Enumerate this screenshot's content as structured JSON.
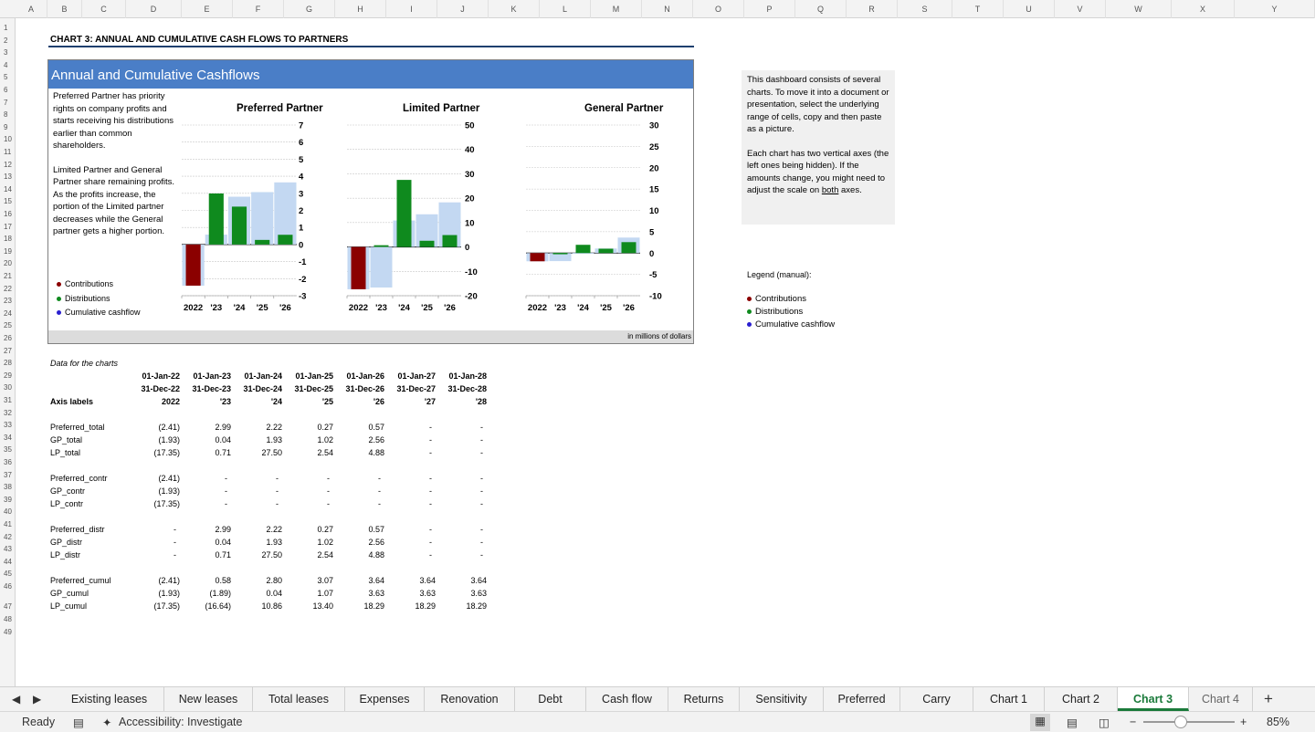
{
  "columns": [
    "A",
    "B",
    "C",
    "D",
    "E",
    "F",
    "G",
    "H",
    "I",
    "J",
    "K",
    "L",
    "M",
    "N",
    "O",
    "P",
    "Q",
    "R",
    "S",
    "T",
    "U",
    "V",
    "W",
    "X",
    "Y"
  ],
  "rows": [
    "1",
    "2",
    "3",
    "4",
    "5",
    "6",
    "7",
    "8",
    "9",
    "10",
    "11",
    "12",
    "13",
    "14",
    "15",
    "16",
    "17",
    "18",
    "19",
    "20",
    "21",
    "22",
    "23",
    "24",
    "25",
    "26",
    "27",
    "28",
    "29",
    "30",
    "31",
    "32",
    "33",
    "34",
    "35",
    "36",
    "37",
    "38",
    "39",
    "40",
    "41",
    "42",
    "43",
    "44",
    "45",
    "46",
    "47",
    "48",
    "49"
  ],
  "sheet_title": "CHART 3: ANNUAL AND CUMULATIVE CASH FLOWS TO PARTNERS",
  "dashboard": {
    "title": "Annual and Cumulative Cashflows",
    "desc_p1": "Preferred Partner has priority rights on company profits and starts receiving his distributions earlier than common shareholders.",
    "desc_p2": "Limited Partner and General Partner share remaining profits. As the profits increase, the portion of the Limited partner decreases while the General partner gets a higher portion.",
    "legend": [
      "Contributions",
      "Distributions",
      "Cumulative cashflow"
    ],
    "footer": "in millions of dollars"
  },
  "colors": {
    "contributions": "#8b0000",
    "distributions": "#0f8a1e",
    "cumulative": "#c3d8f2",
    "legend_cumulative": "#2a1fd0",
    "header": "#4a7ec7",
    "active_tab": "#1a7a3a"
  },
  "chart_data": [
    {
      "type": "bar",
      "title": "Preferred Partner",
      "categories": [
        "2022",
        "'23",
        "'24",
        "'25",
        "'26"
      ],
      "ylim": [
        -3,
        7
      ],
      "yticks": [
        "7",
        "6",
        "5",
        "4",
        "3",
        "2",
        "1",
        "0",
        "-1",
        "-2",
        "-3"
      ],
      "series": [
        {
          "name": "Contributions",
          "values": [
            -2.41,
            0,
            0,
            0,
            0
          ]
        },
        {
          "name": "Distributions",
          "values": [
            0,
            2.99,
            2.22,
            0.27,
            0.57
          ]
        },
        {
          "name": "Cumulative cashflow",
          "values": [
            -2.41,
            0.58,
            2.8,
            3.07,
            3.64
          ]
        }
      ]
    },
    {
      "type": "bar",
      "title": "Limited Partner",
      "categories": [
        "2022",
        "'23",
        "'24",
        "'25",
        "'26"
      ],
      "ylim": [
        -20,
        50
      ],
      "yticks": [
        "50",
        "40",
        "30",
        "20",
        "10",
        "0",
        "-10",
        "-20"
      ],
      "series": [
        {
          "name": "Contributions",
          "values": [
            -17.35,
            0,
            0,
            0,
            0
          ]
        },
        {
          "name": "Distributions",
          "values": [
            0,
            0.71,
            27.5,
            2.54,
            4.88
          ]
        },
        {
          "name": "Cumulative cashflow",
          "values": [
            -17.35,
            -16.64,
            10.86,
            13.4,
            18.29
          ]
        }
      ]
    },
    {
      "type": "bar",
      "title": "General Partner",
      "categories": [
        "2022",
        "'23",
        "'24",
        "'25",
        "'26"
      ],
      "ylim": [
        -10,
        30
      ],
      "yticks": [
        "30",
        "25",
        "20",
        "15",
        "10",
        "5",
        "0",
        "-5",
        "-10"
      ],
      "series": [
        {
          "name": "Contributions",
          "values": [
            -1.93,
            0,
            0,
            0,
            0
          ]
        },
        {
          "name": "Distributions",
          "values": [
            0,
            0.04,
            1.93,
            1.02,
            2.56
          ]
        },
        {
          "name": "Cumulative cashflow",
          "values": [
            -1.93,
            -1.89,
            0.04,
            1.07,
            3.63
          ]
        }
      ]
    }
  ],
  "note": {
    "p1": "This dashboard consists of several charts. To move it into a document or presentation, select the underlying range of cells, copy and then paste as a picture.",
    "p2_a": "Each chart has two vertical axes (the left ones being hidden). If the amounts change, you might need to adjust the scale on ",
    "p2_b": "both",
    "p2_c": " axes.",
    "legend_title": "Legend (manual):"
  },
  "table": {
    "title": "Data for the charts",
    "start_dates": [
      "01-Jan-22",
      "01-Jan-23",
      "01-Jan-24",
      "01-Jan-25",
      "01-Jan-26",
      "01-Jan-27",
      "01-Jan-28"
    ],
    "end_dates": [
      "31-Dec-22",
      "31-Dec-23",
      "31-Dec-24",
      "31-Dec-25",
      "31-Dec-26",
      "31-Dec-27",
      "31-Dec-28"
    ],
    "axis_label_title": "Axis labels",
    "axis_labels": [
      "2022",
      "'23",
      "'24",
      "'25",
      "'26",
      "'27",
      "'28"
    ],
    "groups": [
      [
        {
          "label": "Preferred_total",
          "values": [
            "(2.41)",
            "2.99",
            "2.22",
            "0.27",
            "0.57",
            "-",
            "-"
          ]
        },
        {
          "label": "GP_total",
          "values": [
            "(1.93)",
            "0.04",
            "1.93",
            "1.02",
            "2.56",
            "-",
            "-"
          ]
        },
        {
          "label": "LP_total",
          "values": [
            "(17.35)",
            "0.71",
            "27.50",
            "2.54",
            "4.88",
            "-",
            "-"
          ]
        }
      ],
      [
        {
          "label": "Preferred_contr",
          "values": [
            "(2.41)",
            "-",
            "-",
            "-",
            "-",
            "-",
            "-"
          ]
        },
        {
          "label": "GP_contr",
          "values": [
            "(1.93)",
            "-",
            "-",
            "-",
            "-",
            "-",
            "-"
          ]
        },
        {
          "label": "LP_contr",
          "values": [
            "(17.35)",
            "-",
            "-",
            "-",
            "-",
            "-",
            "-"
          ]
        }
      ],
      [
        {
          "label": "Preferred_distr",
          "values": [
            "-",
            "2.99",
            "2.22",
            "0.27",
            "0.57",
            "-",
            "-"
          ]
        },
        {
          "label": "GP_distr",
          "values": [
            "-",
            "0.04",
            "1.93",
            "1.02",
            "2.56",
            "-",
            "-"
          ]
        },
        {
          "label": "LP_distr",
          "values": [
            "-",
            "0.71",
            "27.50",
            "2.54",
            "4.88",
            "-",
            "-"
          ]
        }
      ],
      [
        {
          "label": "Preferred_cumul",
          "values": [
            "(2.41)",
            "0.58",
            "2.80",
            "3.07",
            "3.64",
            "3.64",
            "3.64"
          ]
        },
        {
          "label": "GP_cumul",
          "values": [
            "(1.93)",
            "(1.89)",
            "0.04",
            "1.07",
            "3.63",
            "3.63",
            "3.63"
          ]
        },
        {
          "label": "LP_cumul",
          "values": [
            "(17.35)",
            "(16.64)",
            "10.86",
            "13.40",
            "18.29",
            "18.29",
            "18.29"
          ]
        }
      ]
    ]
  },
  "tabs": [
    "Existing leases",
    "New leases",
    "Total leases",
    "Expenses",
    "Renovation",
    "Debt",
    "Cash flow",
    "Returns",
    "Sensitivity",
    "Preferred",
    "Carry",
    "Chart 1",
    "Chart 2",
    "Chart 3",
    "Chart 4"
  ],
  "active_tab": "Chart 3",
  "status": {
    "ready": "Ready",
    "accessibility": "Accessibility: Investigate",
    "zoom": "85%"
  }
}
